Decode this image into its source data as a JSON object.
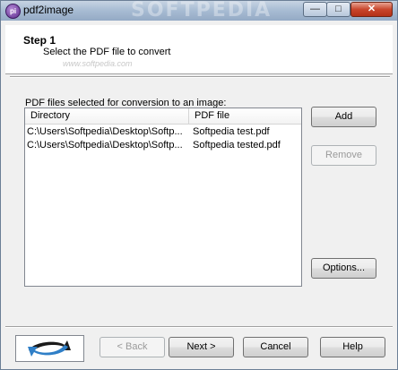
{
  "window": {
    "title": "pdf2image",
    "app_icon_text": "pi",
    "title_watermark": "SOFTPEDIA",
    "min_glyph": "—",
    "max_glyph": "□",
    "close_glyph": "✕"
  },
  "header": {
    "step_title": "Step 1",
    "step_description": "Select the PDF file to convert",
    "watermark": "www.softpedia.com"
  },
  "file_list": {
    "label": "PDF files selected for conversion to an image:",
    "columns": [
      "Directory",
      "PDF file"
    ],
    "rows": [
      {
        "directory": "C:\\Users\\Softpedia\\Desktop\\Softp...",
        "pdf_file": "Softpedia test.pdf"
      },
      {
        "directory": "C:\\Users\\Softpedia\\Desktop\\Softp...",
        "pdf_file": "Softpedia tested.pdf"
      }
    ]
  },
  "side_buttons": {
    "add": "Add",
    "remove": "Remove",
    "options": "Options..."
  },
  "footer": {
    "back": "< Back",
    "next": "Next >",
    "cancel": "Cancel",
    "help": "Help"
  },
  "colors": {
    "logo_dark": "#1a1a1a",
    "logo_blue": "#2f7fc7"
  }
}
